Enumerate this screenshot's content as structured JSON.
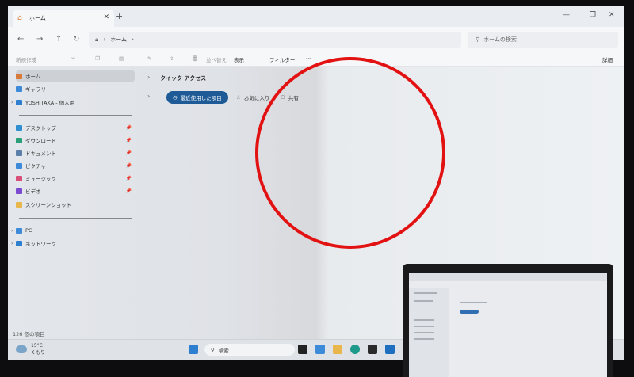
{
  "window": {
    "tab_label": "ホーム",
    "close_glyph": "✕",
    "new_tab_glyph": "+",
    "minimize_glyph": "—",
    "maximize_glyph": "❐",
    "close_window_glyph": "✕"
  },
  "address": {
    "breadcrumb_root": "ホーム",
    "search_placeholder": "ホームの検索"
  },
  "toolbar": {
    "new_label": "新規作成",
    "sort_label": "並べ替え",
    "view_label": "表示",
    "filter_label": "フィルター",
    "more_label": "···",
    "details_label": "詳細"
  },
  "sidebar": {
    "items": [
      {
        "label": "ホーム",
        "icon": "home-icon"
      },
      {
        "label": "ギャラリー",
        "icon": "gallery-icon"
      },
      {
        "label": "YOSHITAKA - 個人用",
        "icon": "folder-icon"
      },
      {
        "label": "デスクトップ",
        "icon": "desktop-icon"
      },
      {
        "label": "ダウンロード",
        "icon": "download-icon"
      },
      {
        "label": "ドキュメント",
        "icon": "document-icon"
      },
      {
        "label": "ピクチャ",
        "icon": "pictures-icon"
      },
      {
        "label": "ミュージック",
        "icon": "music-icon"
      },
      {
        "label": "ビデオ",
        "icon": "video-icon"
      },
      {
        "label": "スクリーンショット",
        "icon": "folder-icon"
      },
      {
        "label": "PC",
        "icon": "pc-icon"
      },
      {
        "label": "ネットワーク",
        "icon": "network-icon"
      }
    ]
  },
  "main": {
    "section_title": "クイック アクセス",
    "tabs": [
      {
        "label": "最近使用した項目"
      },
      {
        "label": "お気に入り"
      },
      {
        "label": "共有"
      }
    ]
  },
  "status": {
    "item_count": "126 個の項目"
  },
  "taskbar": {
    "temperature": "15°C",
    "weather_text": "くもり",
    "search_label": "検索"
  },
  "colors": {
    "accent": "#1e5a96",
    "annotation_circle": "#e31212",
    "folder_yellow": "#e8b64a"
  }
}
